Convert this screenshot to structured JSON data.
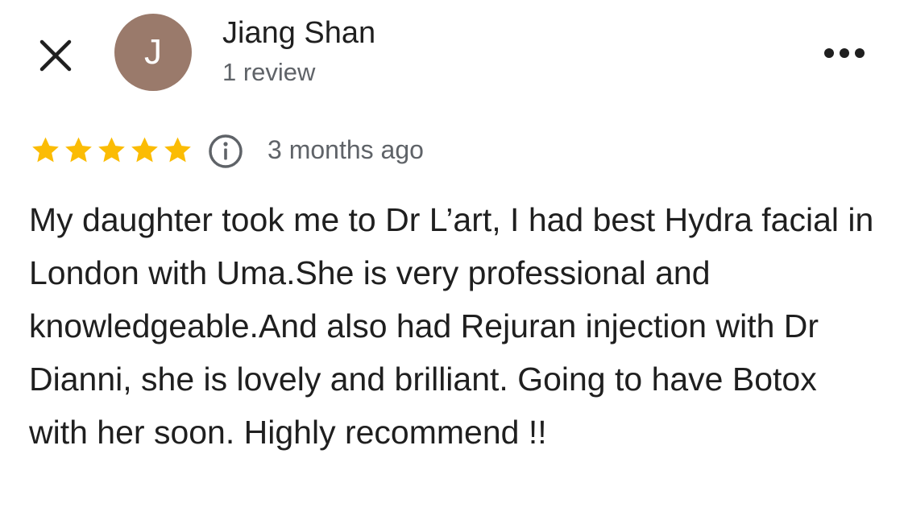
{
  "reviewer": {
    "name": "Jiang Shan",
    "review_count": "1 review",
    "avatar_initial": "J",
    "avatar_color": "#9a7a6b"
  },
  "header": {
    "close_icon": "close-icon",
    "more_icon": "more-horizontal-icon"
  },
  "review": {
    "rating": 5,
    "rating_max": 5,
    "star_color": "#fbbc04",
    "info_icon": "info-icon",
    "time_ago": "3 months ago",
    "text": "My daughter took me to Dr L’art, I had best Hydra facial in London with Uma.She is very professional and knowledgeable.And also had Rejuran injection with Dr Dianni, she is lovely and brilliant. Going to have Botox with her soon. Highly recommend !!"
  }
}
